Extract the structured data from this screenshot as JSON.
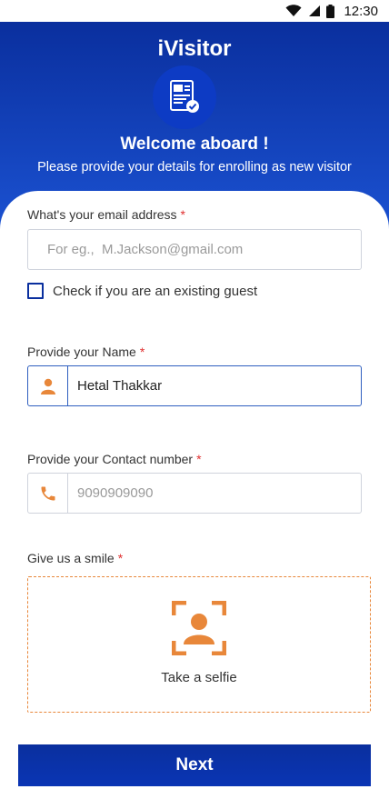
{
  "status_bar": {
    "time": "12:30"
  },
  "header": {
    "app_title": "iVisitor",
    "welcome": "Welcome aboard !",
    "subtitle": "Please provide your details for enrolling as new visitor"
  },
  "form": {
    "email": {
      "label": "What's your email address",
      "required": "*",
      "placeholder": "For eg.,  M.Jackson@gmail.com",
      "value": ""
    },
    "existing_guest": {
      "label": "Check if you are an existing guest",
      "checked": false
    },
    "name": {
      "label": "Provide your Name",
      "required": "*",
      "value": "Hetal Thakkar"
    },
    "contact": {
      "label": "Provide your Contact number",
      "required": "*",
      "placeholder": "9090909090",
      "value": ""
    },
    "selfie": {
      "label": "Give us a smile",
      "required": "*",
      "action": "Take a selfie"
    }
  },
  "next_button": {
    "label": "Next"
  },
  "colors": {
    "primary": "#0a2f9e",
    "accent": "#e8873a",
    "required": "#e03030"
  },
  "icons": [
    "wifi-icon",
    "signal-icon",
    "battery-icon",
    "visitor-badge-icon",
    "person-icon",
    "phone-icon",
    "camera-frame-icon"
  ]
}
